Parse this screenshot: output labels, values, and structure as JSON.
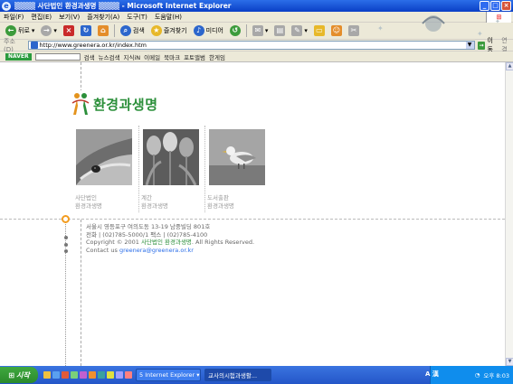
{
  "window": {
    "title": "▒▒▒▒ 사단법인 환경과생명 ▒▒▒▒ - Microsoft Internet Explorer"
  },
  "menu": [
    "파일(F)",
    "편집(E)",
    "보기(V)",
    "즐겨찾기(A)",
    "도구(T)",
    "도움말(H)"
  ],
  "toolbar": {
    "back": "뒤로",
    "search": "검색",
    "favorites": "즐겨찾기",
    "media": "미디어"
  },
  "address": {
    "label": "주소(D)",
    "url": "http://www.greenera.or.kr/index.htm",
    "go": "이동",
    "links": "연결"
  },
  "naver": {
    "logo": "NAVER",
    "search": "검색",
    "items": [
      "뉴스검색",
      "지식iN",
      "이메일",
      "북마크",
      "포토앨범",
      "한게임"
    ]
  },
  "site": {
    "logo_text": "환경과생명",
    "columns": [
      {
        "line1": "사단법인",
        "line2": "환경과생명"
      },
      {
        "line1": "계간",
        "line2": "환경과생명"
      },
      {
        "line1": "도서출판",
        "line2": "환경과생명"
      }
    ],
    "footer": {
      "address": "서울시 영등포구 여의도동 13-19 남중빌딩 801호",
      "phone": "전화 | (02)785-5000/1  팩스 | (02)785-4100",
      "copyright_pre": "Copyright © 2001 ",
      "copyright_org": "사단법인 환경과생명",
      "copyright_post": ". All Rights Reserved.",
      "contact_pre": "Contact us ",
      "email": "greenera@greenera.or.kr"
    }
  },
  "taskbar": {
    "start": "시작",
    "tasks": [
      "5 Internet Explorer",
      "교사의시험과생활..."
    ],
    "ime": "A 漢",
    "clock": "오후 8:03"
  }
}
